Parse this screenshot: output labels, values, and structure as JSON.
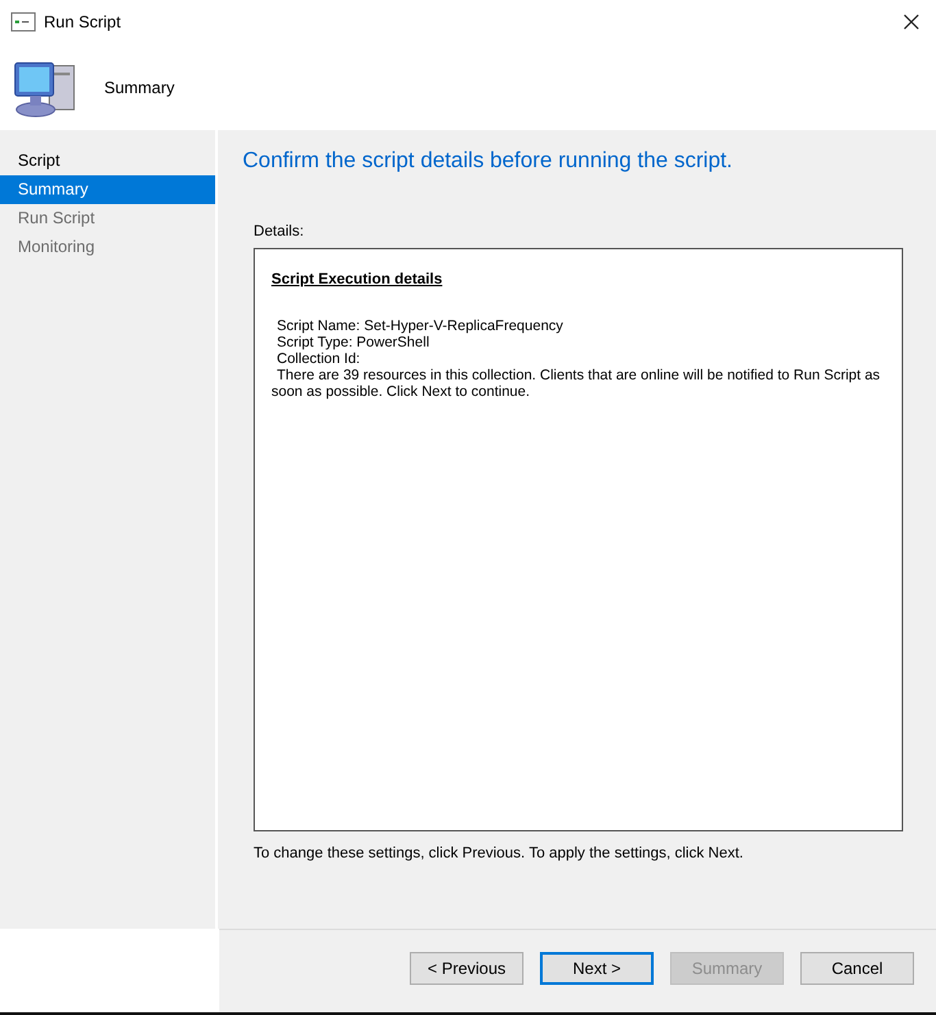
{
  "window": {
    "title": "Run Script"
  },
  "header": {
    "title": "Summary"
  },
  "sidebar": {
    "items": [
      {
        "label": "Script",
        "selected": false,
        "disabled": false
      },
      {
        "label": "Summary",
        "selected": true,
        "disabled": false
      },
      {
        "label": "Run Script",
        "selected": false,
        "disabled": true
      },
      {
        "label": "Monitoring",
        "selected": false,
        "disabled": true
      }
    ]
  },
  "content": {
    "heading": "Confirm the script details before running the script.",
    "details_label": "Details:",
    "details": {
      "title": "Script Execution details",
      "lines": [
        "Script Name: Set-Hyper-V-ReplicaFrequency",
        "Script Type: PowerShell",
        "Collection Id:"
      ],
      "message": "There are 39 resources in this collection. Clients that are online will be notified to Run Script as soon as possible. Click Next to continue."
    },
    "hint": "To change these settings, click Previous. To apply the settings, click Next."
  },
  "buttons": [
    {
      "label": "< Previous",
      "default": false,
      "disabled": false
    },
    {
      "label": "Next >",
      "default": true,
      "disabled": false
    },
    {
      "label": "Summary",
      "default": false,
      "disabled": true
    },
    {
      "label": "Cancel",
      "default": false,
      "disabled": false
    }
  ]
}
